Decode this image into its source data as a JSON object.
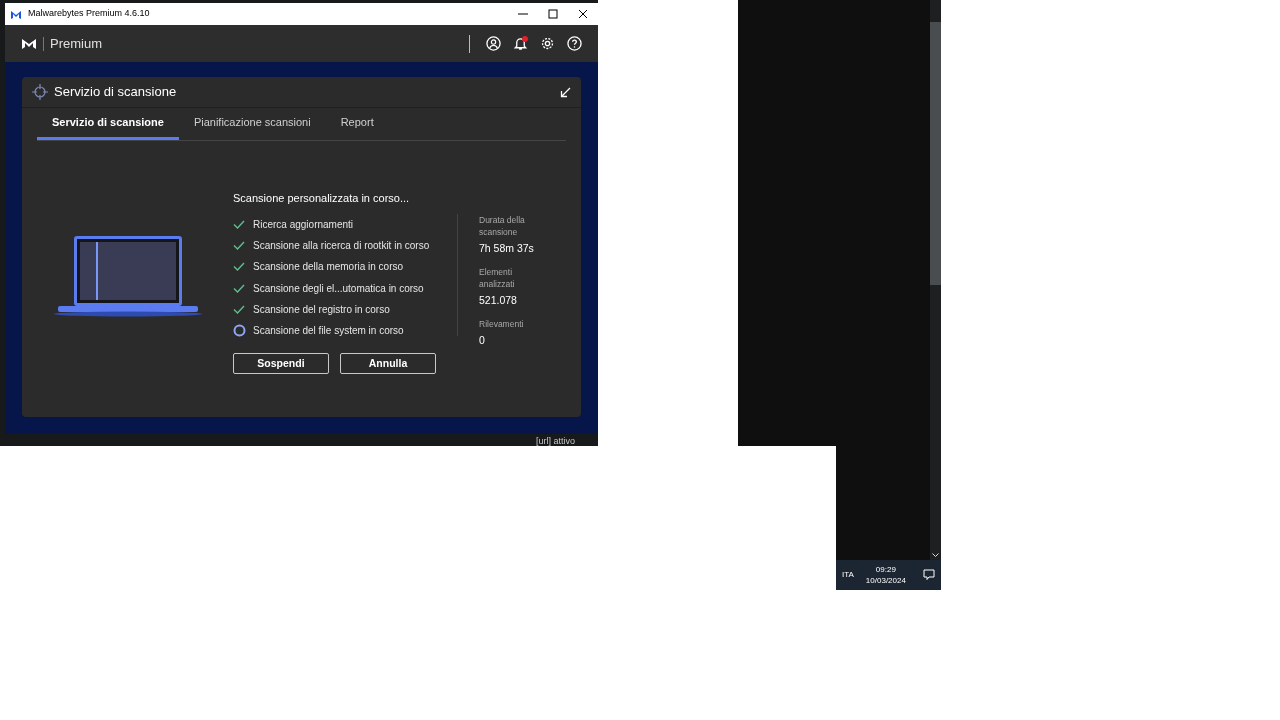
{
  "window": {
    "title": "Malwarebytes Premium 4.6.10"
  },
  "header": {
    "brand": "Premium",
    "notification_badge": true
  },
  "card": {
    "title": "Servizio di scansione",
    "tabs": [
      {
        "label": "Servizio di scansione",
        "selected": true
      },
      {
        "label": "Pianificazione scansioni",
        "selected": false
      },
      {
        "label": "Report",
        "selected": false
      }
    ],
    "heading": "Scansione personalizzata in corso...",
    "steps": [
      {
        "label": "Ricerca aggiornamenti",
        "kind": "done"
      },
      {
        "label": "Scansione alla ricerca di rootkit in corso",
        "kind": "done"
      },
      {
        "label": "Scansione della memoria in corso",
        "kind": "done"
      },
      {
        "label": "Scansione degli el...utomatica in corso",
        "kind": "done"
      },
      {
        "label": "Scansione del registro in corso",
        "kind": "done"
      },
      {
        "label": "Scansione del file system in corso",
        "kind": "running"
      }
    ],
    "buttons": [
      "Sospendi",
      "Annulla"
    ],
    "stats": [
      {
        "label": "Durata della scansione",
        "value": "7h 58m 37s"
      },
      {
        "label": "Elementi analizzati",
        "value": "521.078"
      },
      {
        "label": "Rilevamenti",
        "value": "0"
      }
    ]
  },
  "background_texts": [
    "[url] attivo"
  ],
  "taskbar": {
    "language": "ITA",
    "time": "09:29",
    "date": "10/03/2024"
  }
}
